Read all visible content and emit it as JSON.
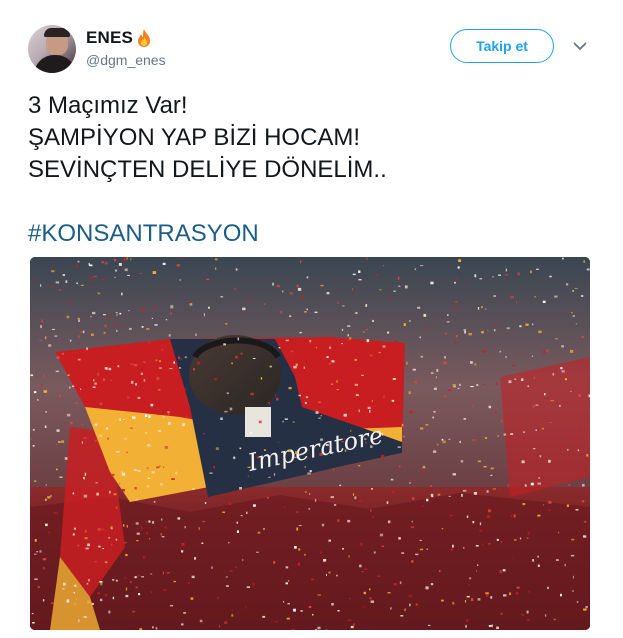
{
  "author": {
    "display_name": "ENES",
    "handle": "@dgm_enes",
    "name_emoji": "fire-icon"
  },
  "actions": {
    "follow_label": "Takip et",
    "more_icon": "chevron-down-icon"
  },
  "tweet": {
    "lines": [
      "3 Maçımız Var!",
      "ŞAMPİYON YAP BİZİ HOCAM!",
      "SEVİNÇTEN DELİYE DÖNELİM.."
    ],
    "hashtag": "#KONSANTRASYON"
  },
  "media": {
    "flag_text": "Imperatore"
  },
  "colors": {
    "accent": "#1da1f2",
    "hashtag": "#1c5d88",
    "flag_red": "#c81e22",
    "flag_yellow": "#f2b134"
  }
}
